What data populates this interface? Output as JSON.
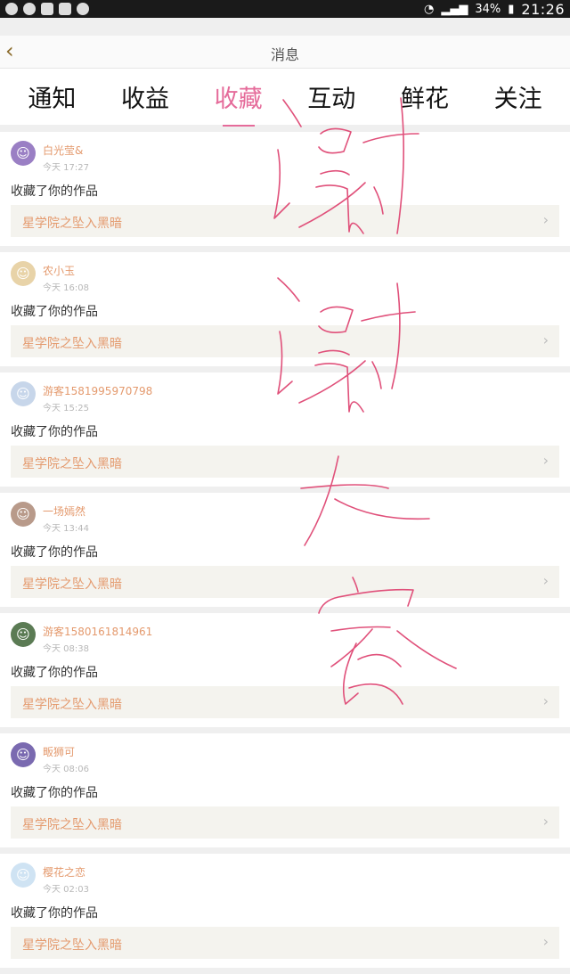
{
  "status": {
    "battery": "34%",
    "time": "21:26"
  },
  "header": {
    "title": "消息",
    "back_glyph": "‹"
  },
  "tabs": [
    {
      "label": "通知"
    },
    {
      "label": "收益"
    },
    {
      "label": "收藏"
    },
    {
      "label": "互动"
    },
    {
      "label": "鲜花"
    },
    {
      "label": "关注"
    }
  ],
  "active_tab": "收藏",
  "accent": "#e56b9a",
  "notifications": [
    {
      "user": "白光莹&",
      "time": "今天 17:27",
      "action": "收藏了你的作品",
      "work": "星学院之坠入黑暗"
    },
    {
      "user": "农小玉",
      "time": "今天 16:08",
      "action": "收藏了你的作品",
      "work": "星学院之坠入黑暗"
    },
    {
      "user": "游客1581995970798",
      "time": "今天 15:25",
      "action": "收藏了你的作品",
      "work": "星学院之坠入黑暗"
    },
    {
      "user": "一场嫣然",
      "time": "今天 13:44",
      "action": "收藏了你的作品",
      "work": "星学院之坠入黑暗"
    },
    {
      "user": "游客1580161814961",
      "time": "今天 08:38",
      "action": "收藏了你的作品",
      "work": "星学院之坠入黑暗"
    },
    {
      "user": "畈狮可",
      "time": "今天 08:06",
      "action": "收藏了你的作品",
      "work": "星学院之坠入黑暗"
    },
    {
      "user": "樱花之恋",
      "time": "今天 02:03",
      "action": "收藏了你的作品",
      "work": "星学院之坠入黑暗"
    }
  ],
  "handwriting": {
    "color": "#e0507a",
    "text": "谢谢大家"
  }
}
